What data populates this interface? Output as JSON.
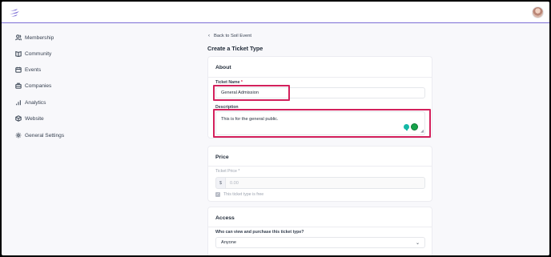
{
  "nav": {
    "items": [
      {
        "label": "Membership",
        "icon": "users-icon"
      },
      {
        "label": "Community",
        "icon": "book-icon"
      },
      {
        "label": "Events",
        "icon": "calendar-icon"
      },
      {
        "label": "Companies",
        "icon": "building-icon"
      },
      {
        "label": "Analytics",
        "icon": "bar-chart-icon"
      },
      {
        "label": "Website",
        "icon": "cube-icon"
      },
      {
        "label": "General Settings",
        "icon": "gear-icon"
      }
    ]
  },
  "header": {
    "back_label": "Back to Soil Event",
    "title": "Create a Ticket Type"
  },
  "about": {
    "title": "About",
    "ticket_name_label": "Ticket Name",
    "required_mark": "*",
    "ticket_name_value": "General Admission",
    "description_label": "Description",
    "description_value": "This is for the general public."
  },
  "price": {
    "title": "Price",
    "ticket_price_label": "Ticket Price *",
    "currency_prefix": "$",
    "price_placeholder": "0.00",
    "free_checkbox_label": "This ticket type is free",
    "free_checked": true
  },
  "access": {
    "title": "Access",
    "question_label": "Who can view and purchase this ticket type?",
    "selected_option": "Anyone"
  },
  "colors": {
    "accent": "#7c6fd6",
    "highlight": "#d3205c",
    "required": "#e11d48"
  }
}
